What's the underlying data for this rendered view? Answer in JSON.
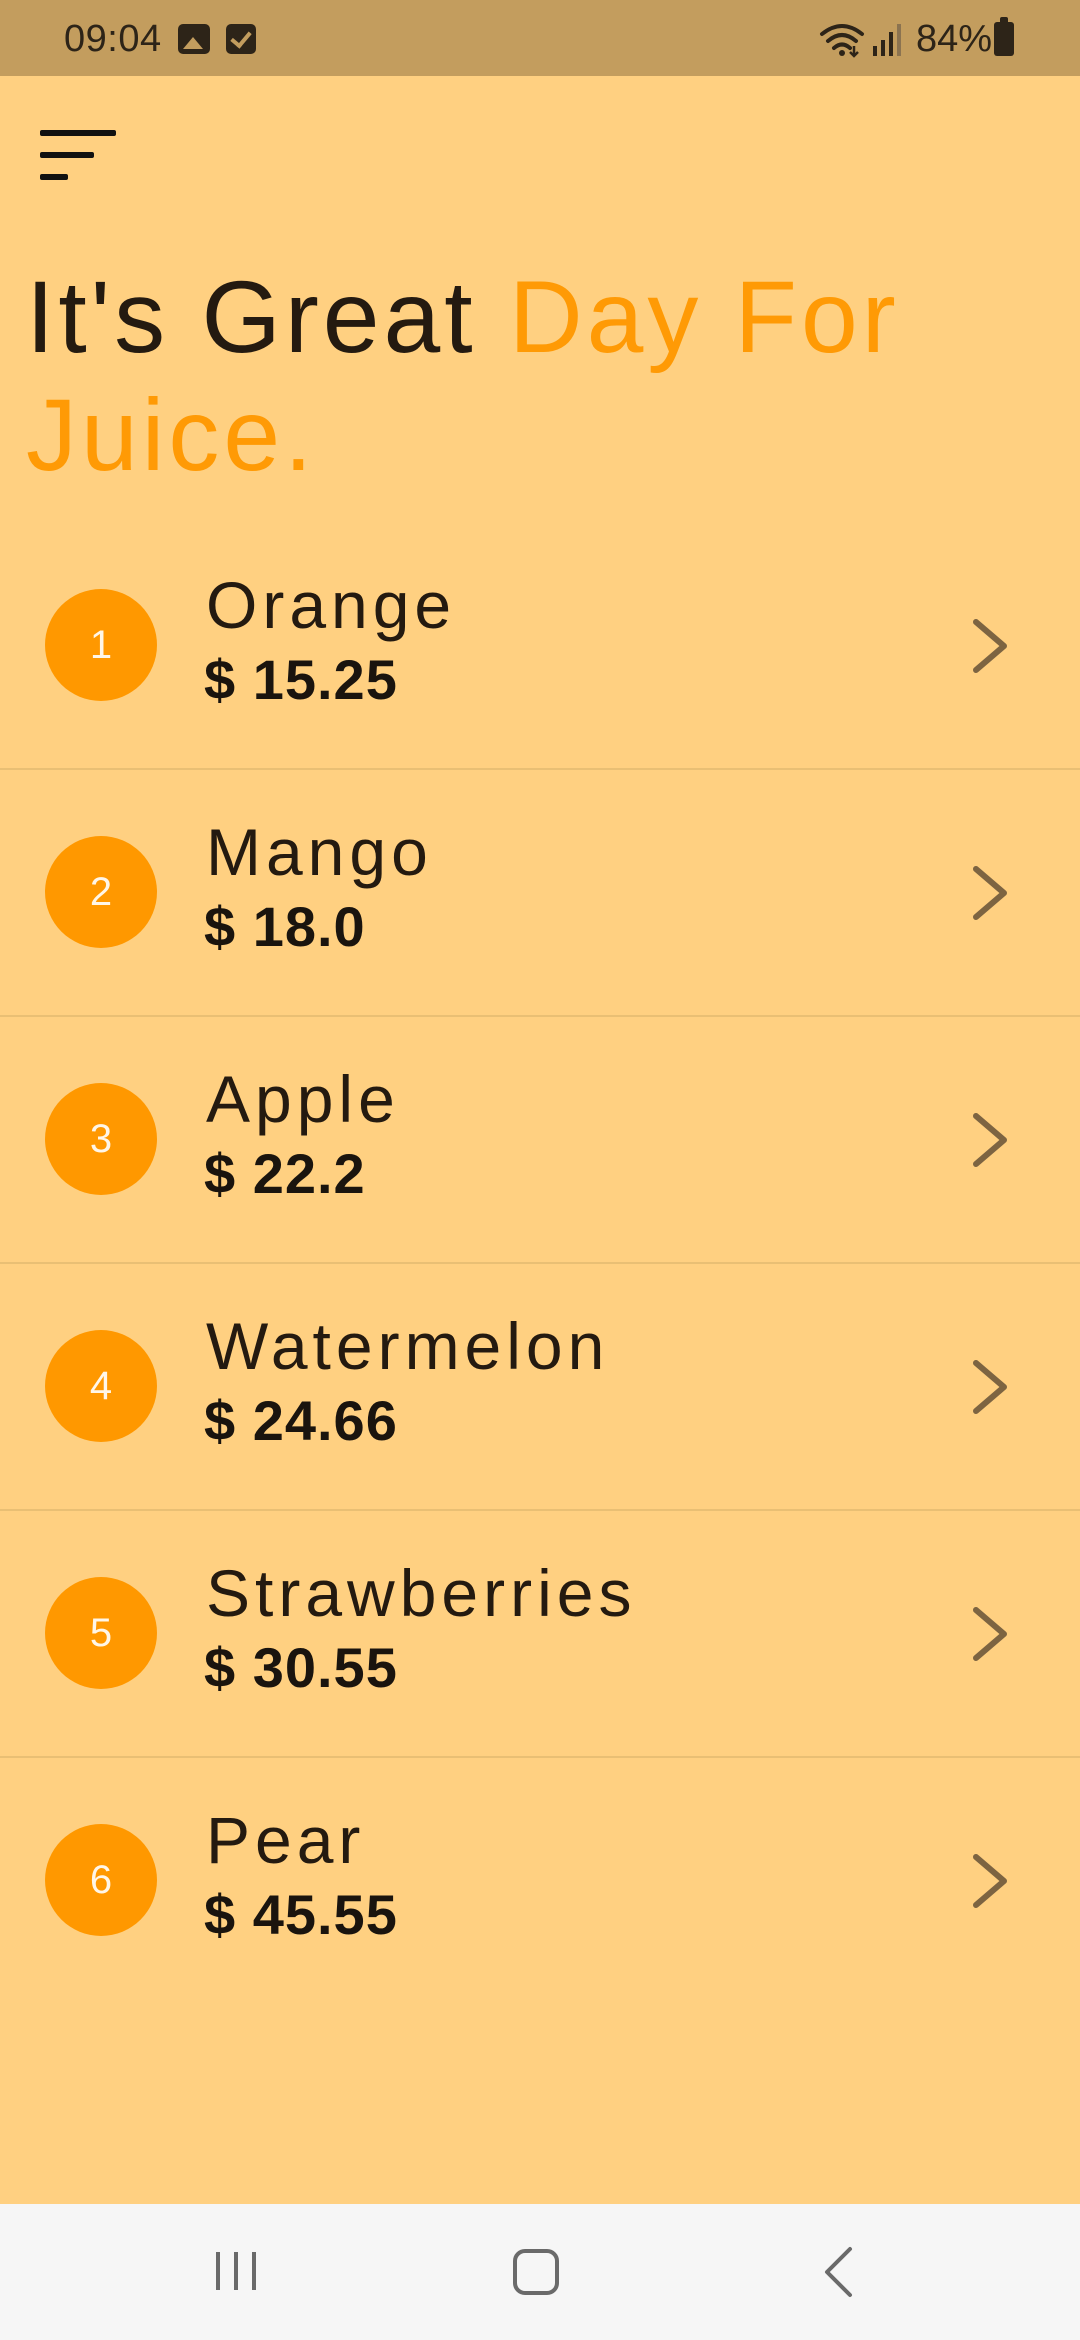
{
  "status_bar": {
    "time": "09:04",
    "battery": "84%",
    "icons": [
      "image-icon",
      "checkbox-icon",
      "wifi-icon",
      "signal-icon",
      "battery-icon"
    ]
  },
  "header": {
    "menu_icon": "menu-icon",
    "title_part1": "It's Great ",
    "title_part2": "Day For Juice."
  },
  "colors": {
    "background": "#ffd081",
    "status_bar": "#c39d5e",
    "accent": "#ff9800",
    "text_dark": "#241a10",
    "chevron": "#7d6441",
    "nav_bar": "#f6f6f6"
  },
  "juices": [
    {
      "number": "1",
      "name": "Orange",
      "price": "$ 15.25"
    },
    {
      "number": "2",
      "name": "Mango",
      "price": "$ 18.0"
    },
    {
      "number": "3",
      "name": "Apple",
      "price": "$ 22.2"
    },
    {
      "number": "4",
      "name": "Watermelon",
      "price": "$ 24.66"
    },
    {
      "number": "5",
      "name": "Strawberries",
      "price": "$ 30.55"
    },
    {
      "number": "6",
      "name": "Pear",
      "price": "$ 45.55"
    }
  ],
  "nav_bar": {
    "icons": [
      "recents-icon",
      "home-icon",
      "back-icon"
    ]
  }
}
